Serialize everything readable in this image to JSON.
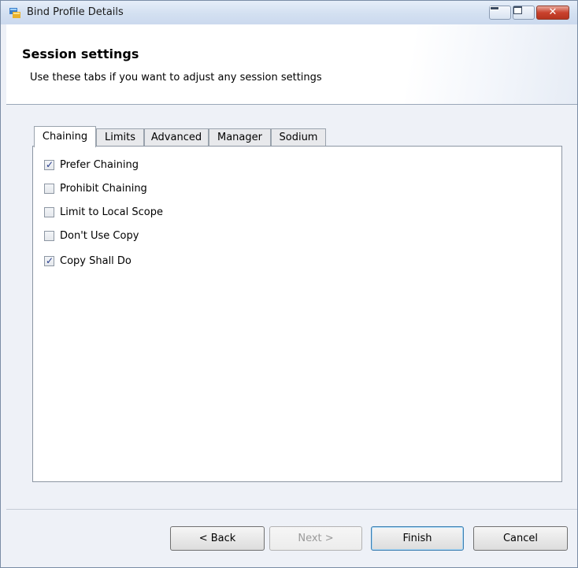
{
  "window": {
    "title": "Bind Profile Details",
    "close_glyph": "✕"
  },
  "header": {
    "title": "Session settings",
    "subtitle": "Use these tabs if you want to adjust any session settings"
  },
  "tabs": [
    {
      "label": "Chaining",
      "active": true
    },
    {
      "label": "Limits",
      "active": false
    },
    {
      "label": "Advanced",
      "active": false
    },
    {
      "label": "Manager",
      "active": false
    },
    {
      "label": "Sodium",
      "active": false
    }
  ],
  "options": [
    {
      "label": "Prefer Chaining",
      "checked": true
    },
    {
      "label": "Prohibit Chaining",
      "checked": false
    },
    {
      "label": "Limit to Local Scope",
      "checked": false
    },
    {
      "label": "Don't Use Copy",
      "checked": false
    },
    {
      "label": "Copy Shall Do",
      "checked": true
    }
  ],
  "buttons": {
    "back": "< Back",
    "next": "Next >",
    "finish": "Finish",
    "cancel": "Cancel"
  },
  "colors": {
    "check": "#243a8a",
    "close_button": "#c9422d"
  }
}
